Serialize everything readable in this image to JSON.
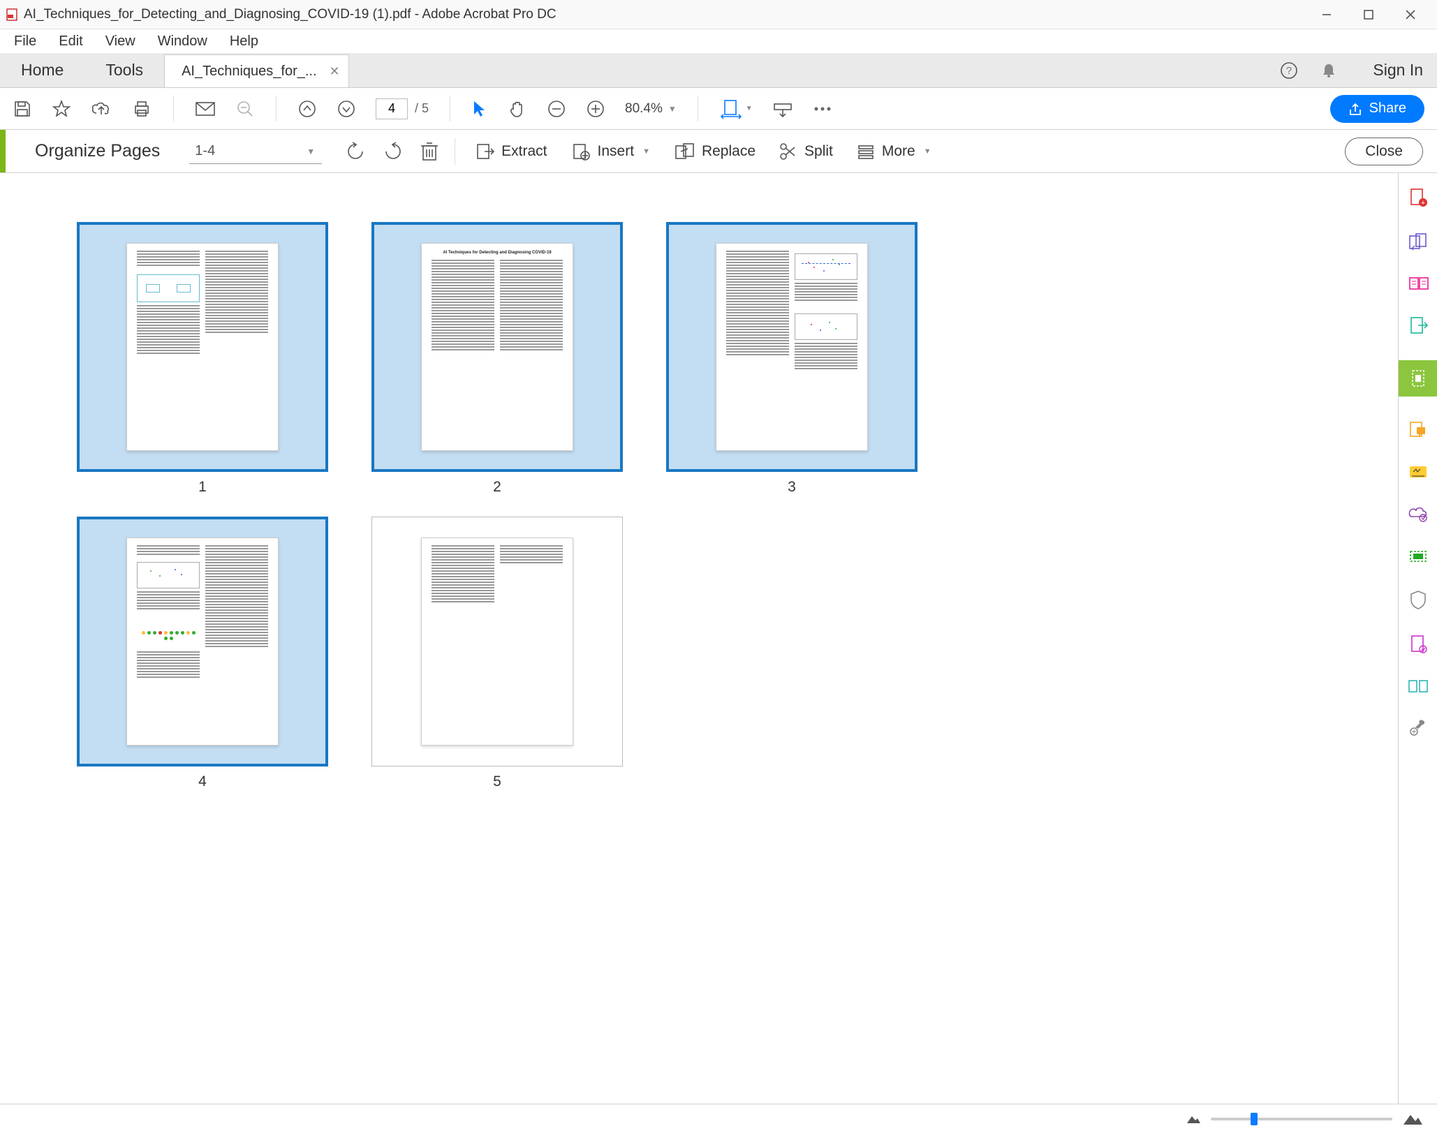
{
  "titlebar": {
    "filename": "AI_Techniques_for_Detecting_and_Diagnosing_COVID-19 (1).pdf - Adobe Acrobat Pro DC"
  },
  "menubar": {
    "items": [
      "File",
      "Edit",
      "View",
      "Window",
      "Help"
    ]
  },
  "tabs": {
    "home": "Home",
    "tools": "Tools",
    "doc_tab": "AI_Techniques_for_...",
    "signin": "Sign In"
  },
  "toolbar": {
    "page_current": "4",
    "page_total": "/   5",
    "zoom_level": "80.4%",
    "share": "Share"
  },
  "organize": {
    "title": "Organize Pages",
    "range": "1-4",
    "extract": "Extract",
    "insert": "Insert",
    "replace": "Replace",
    "split": "Split",
    "more": "More",
    "close": "Close"
  },
  "pages": {
    "thumbs": [
      {
        "num": "1",
        "selected": true
      },
      {
        "num": "2",
        "selected": true,
        "title": "AI Techniques for Detecting and Diagnosing COVID-19"
      },
      {
        "num": "3",
        "selected": true
      },
      {
        "num": "4",
        "selected": true
      },
      {
        "num": "5",
        "selected": false
      }
    ]
  }
}
